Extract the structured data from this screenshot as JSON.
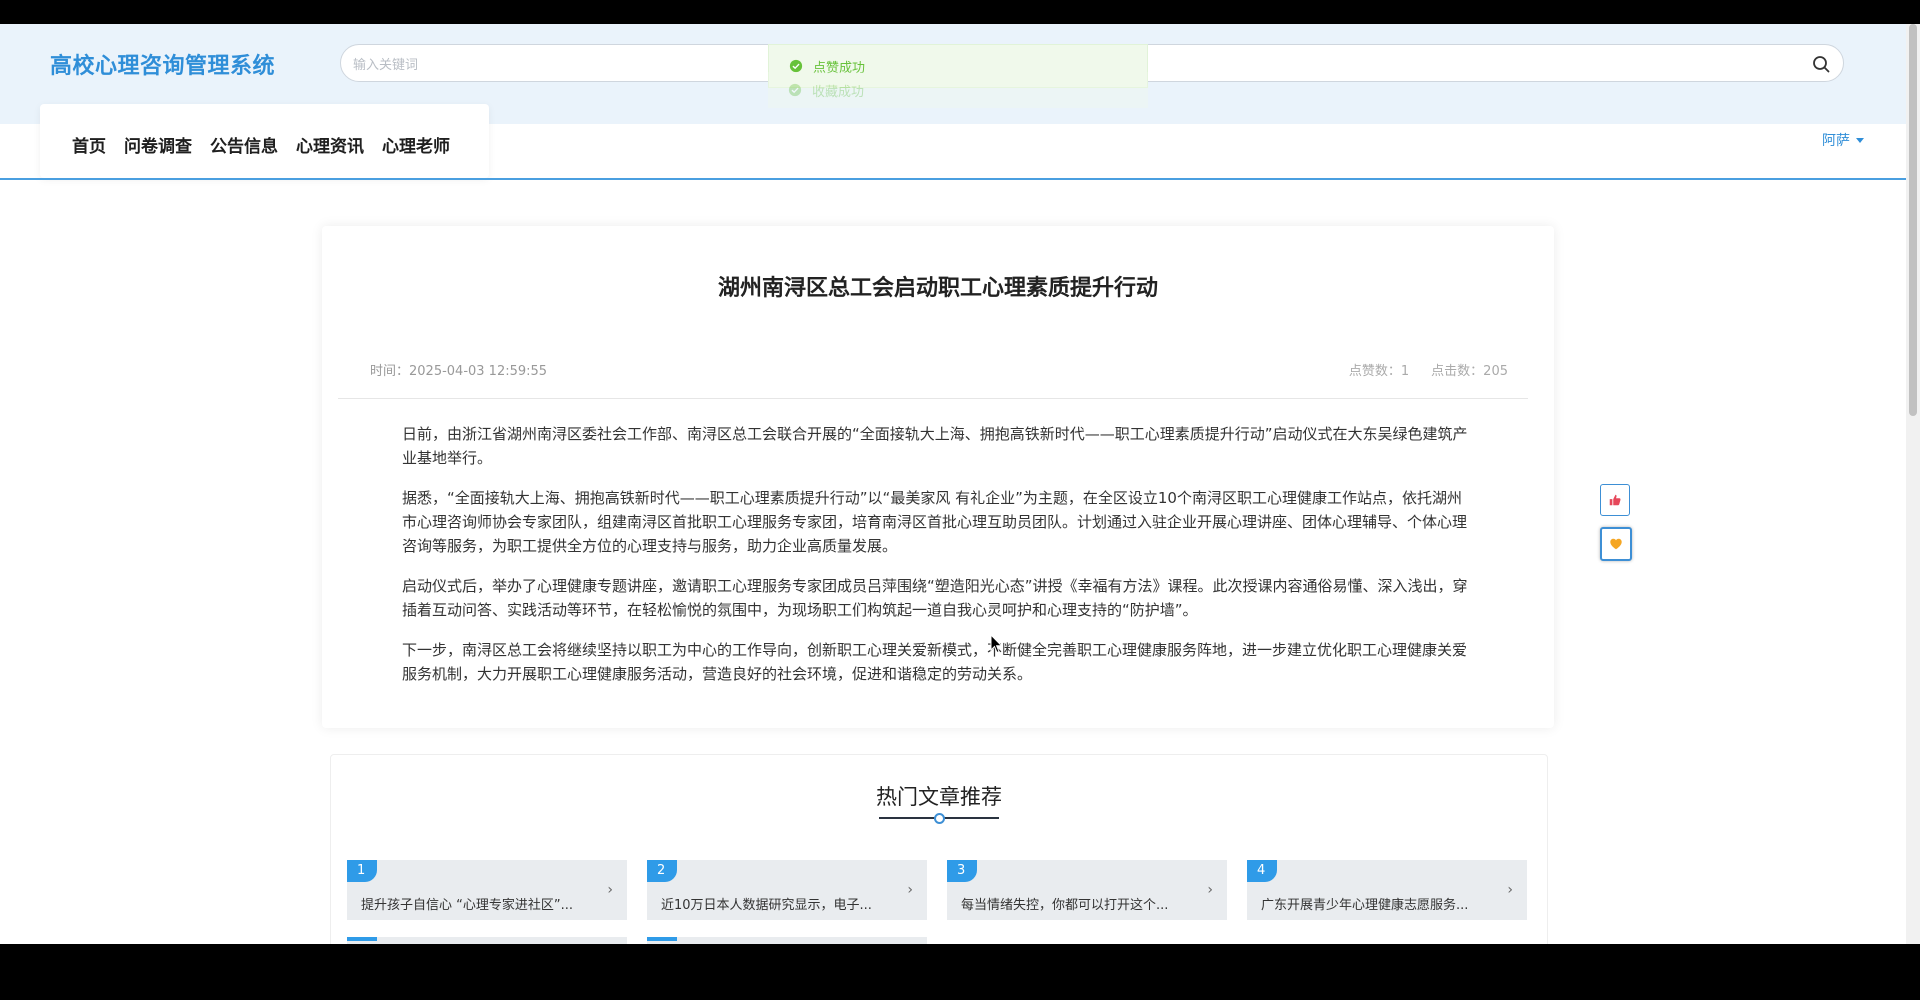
{
  "header": {
    "site_title": "高校心理咨询管理系统",
    "search_placeholder": "输入关键词"
  },
  "toasts": [
    "点赞成功",
    "收藏成功"
  ],
  "nav": {
    "items": [
      {
        "label": "首页"
      },
      {
        "label": "问卷调查"
      },
      {
        "label": "公告信息"
      },
      {
        "label": "心理资讯"
      },
      {
        "label": "心理老师"
      }
    ],
    "user": "阿萨"
  },
  "article": {
    "title": "湖州南浔区总工会启动职工心理素质提升行动",
    "time": "时间：2025-04-03 12:59:55",
    "likes": "点赞数：1",
    "clicks": "点击数：205",
    "paragraphs": [
      "日前，由浙江省湖州南浔区委社会工作部、南浔区总工会联合开展的“全面接轨大上海、拥抱高铁新时代——职工心理素质提升行动”启动仪式在大东吴绿色建筑产业基地举行。",
      "据悉，“全面接轨大上海、拥抱高铁新时代——职工心理素质提升行动”以“最美家风 有礼企业”为主题，在全区设立10个南浔区职工心理健康工作站点，依托湖州市心理咨询师协会专家团队，组建南浔区首批职工心理服务专家团，培育南浔区首批心理互助员团队。计划通过入驻企业开展心理讲座、团体心理辅导、个体心理咨询等服务，为职工提供全方位的心理支持与服务，助力企业高质量发展。",
      "启动仪式后，举办了心理健康专题讲座，邀请职工心理服务专家团成员吕萍围绕“塑造阳光心态”讲授《幸福有方法》课程。此次授课内容通俗易懂、深入浅出，穿插着互动问答、实践活动等环节，在轻松愉悦的氛围中，为现场职工们构筑起一道自我心灵呵护和心理支持的“防护墙”。",
      "下一步，南浔区总工会将继续坚持以职工为中心的工作导向，创新职工心理关爱新模式，不断健全完善职工心理健康服务阵地，进一步建立优化职工心理健康关爱服务机制，大力开展职工心理健康服务活动，营造良好的社会环境，促进和谐稳定的劳动关系。"
    ]
  },
  "hot": {
    "title": "热门文章推荐",
    "items": [
      {
        "num": "1",
        "text": "提升孩子自信心 “心理专家进社区”..."
      },
      {
        "num": "2",
        "text": "近10万日本人数据研究显示，电子..."
      },
      {
        "num": "3",
        "text": "每当情绪失控，你都可以打开这个..."
      },
      {
        "num": "4",
        "text": "广东开展青少年心理健康志愿服务..."
      }
    ]
  },
  "colors": {
    "accent": "#2f8ed8",
    "success": "#67c23a",
    "header_bg": "#eaf3fb",
    "badge": "#2f9be8"
  }
}
